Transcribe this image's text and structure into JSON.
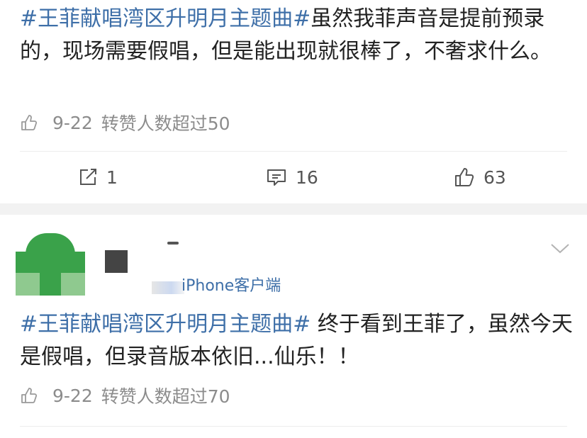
{
  "post1": {
    "tag": "#王菲献唱湾区升明月主题曲#",
    "text": "虽然我菲声音是提前预录的，现场需要假唱，但是能出现就很棒了，不奢求什么。",
    "date": "9-22",
    "meta": "转赞人数超过50",
    "actions": {
      "repost_count": "1",
      "comment_count": "16",
      "like_count": "63"
    }
  },
  "post2": {
    "source": "iPhone客户端",
    "tag": "#王菲献唱湾区升明月主题曲#",
    "text": " 终于看到王菲了，虽然今天是假唱，但录音版本依旧...仙乐！！",
    "date": "9-22",
    "meta": "转赞人数超过70"
  },
  "colors": {
    "tag": "#3e6fa8",
    "meta": "#8c8c8c",
    "avatar_green": "#3aa24a"
  },
  "icons": [
    "like-icon",
    "repost-icon",
    "comment-icon",
    "chevron-down-icon"
  ]
}
